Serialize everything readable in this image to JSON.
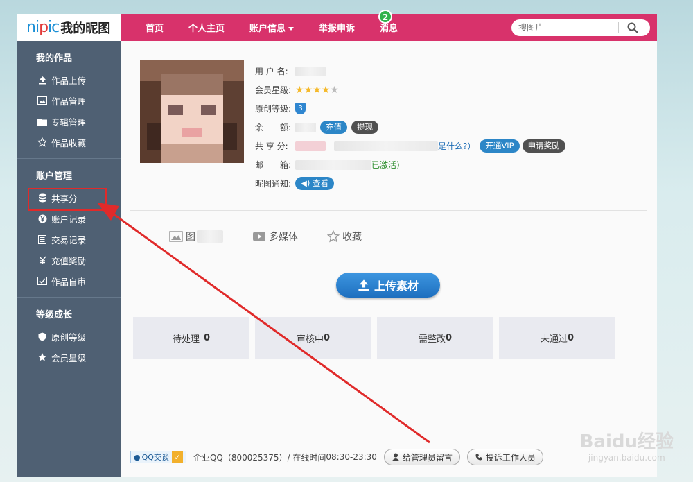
{
  "logo": {
    "en_prefix": "ni",
    "en_mid": "p",
    "en_suffix": "ic",
    "cn": "我的昵图"
  },
  "topnav": {
    "items": [
      {
        "label": "首页"
      },
      {
        "label": "个人主页"
      },
      {
        "label": "账户信息"
      },
      {
        "label": "举报申诉"
      },
      {
        "label": "消息"
      }
    ],
    "message_count": "2",
    "search_placeholder": "搜图片"
  },
  "sidebar": {
    "sections": [
      {
        "title": "我的作品",
        "items": [
          {
            "label": "作品上传",
            "icon": "upload-icon"
          },
          {
            "label": "作品管理",
            "icon": "image-icon"
          },
          {
            "label": "专辑管理",
            "icon": "folder-icon"
          },
          {
            "label": "作品收藏",
            "icon": "star-icon"
          }
        ]
      },
      {
        "title": "账户管理",
        "items": [
          {
            "label": "共享分",
            "icon": "database-icon",
            "active": true
          },
          {
            "label": "账户记录",
            "icon": "yen-icon"
          },
          {
            "label": "交易记录",
            "icon": "list-icon"
          },
          {
            "label": "充值奖励",
            "icon": "yen-scissor-icon"
          },
          {
            "label": "作品自审",
            "icon": "check-image-icon"
          }
        ]
      },
      {
        "title": "等级成长",
        "items": [
          {
            "label": "原创等级",
            "icon": "shield-icon"
          },
          {
            "label": "会员星级",
            "icon": "star-filled-icon"
          }
        ]
      }
    ]
  },
  "profile": {
    "username_label": "用 户 名:",
    "member_level_label": "会员星级:",
    "stars_on": 4,
    "stars_total": 5,
    "original_level_label": "原创等级:",
    "original_level": "3",
    "balance_label": "余　　额:",
    "recharge_label": "充值",
    "withdraw_label": "提现",
    "share_label": "共 享 分:",
    "share_what": "是什么?）",
    "vip_label": "开通VIP",
    "reward_label": "申请奖励",
    "email_label": "邮　　箱:",
    "email_status": "已激活)",
    "notify_label": "昵图通知:",
    "view_label": "查看"
  },
  "tabs": [
    {
      "label": "图",
      "icon": "image-icon"
    },
    {
      "label": "多媒体",
      "icon": "play-icon"
    },
    {
      "label": "收藏",
      "icon": "star-outline-icon"
    }
  ],
  "upload_button": "上传素材",
  "stats": [
    {
      "label": "待处理",
      "value": "0"
    },
    {
      "label": "审核中",
      "value": "0"
    },
    {
      "label": "需整改",
      "value": "0"
    },
    {
      "label": "未通过",
      "value": "0"
    }
  ],
  "footer": {
    "qq_label": "QQ交谈",
    "enterprise_qq": "企业QQ（800025375）/ 在线时间",
    "online_time": "08:30-23:30",
    "leave_msg": "给管理员留言",
    "complain": "投诉工作人员"
  },
  "watermark": {
    "main": "Baidu经验",
    "sub": "jingyan.baidu.com"
  },
  "colors": {
    "nav": "#d8326b",
    "sidebar": "#4f6073",
    "accent": "#2c86c7",
    "annotation": "#e02a2a"
  }
}
